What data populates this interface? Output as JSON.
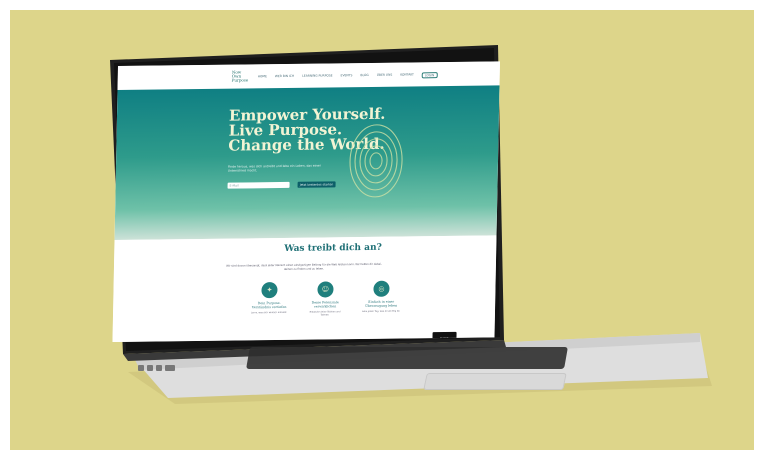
{
  "website": {
    "logo_text": "Now Own\nPurpose",
    "nav_items": [
      "HOME",
      "WER BIN ICH",
      "LEARNING PURPOSE",
      "EVENTS",
      "BLOG",
      "ÜBER UNS",
      "KONTAKT",
      "LOGIN"
    ],
    "hero": {
      "headline_lines": [
        "Empower Yourself.",
        "Live Purpose.",
        "Change the World."
      ],
      "subtext": "Finde heraus, was dich antreibt und lebe ein Leben, das einen Unterschied macht.",
      "email_placeholder": "E-Mail",
      "cta_label": "Jetzt kostenlos starten"
    },
    "section": {
      "heading": "Was treibt dich an?",
      "intro": "Wir sind davon überzeugt, dass jeder Mensch einen einzigartigen Beitrag für die Welt leisten kann. Wir helfen dir dabei, deinen zu finden und zu leben.",
      "features": [
        {
          "title": "Dein Purpose-\nVerständnis vertiefen",
          "desc": "Lerne, was dich wirklich antreibt."
        },
        {
          "title": "Deine Potenziale\nverwirklichen",
          "desc": "Entdecke deine Stärken und Talente."
        },
        {
          "title": "Einfach in einer\nÜberzeugung leben",
          "desc": "Lebe jeden Tag, was dir wichtig ist."
        }
      ]
    },
    "tooltip_text": "Zurück"
  },
  "colors": {
    "backdrop": "#ddd58a",
    "hero_top": "#0f7f83",
    "hero_bottom": "#6ec1a8",
    "accent": "#1f6f75"
  }
}
